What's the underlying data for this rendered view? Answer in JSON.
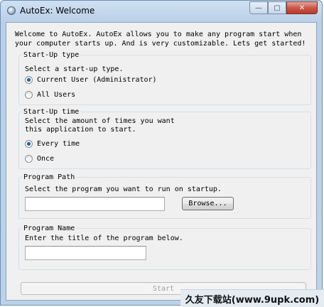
{
  "window": {
    "title": "AutoEx: Welcome"
  },
  "caption_buttons": {
    "minimize": "—",
    "maximize": "▢",
    "close": "✕"
  },
  "welcome_text": "Welcome to AutoEx. AutoEx allows you to make any program start when your computer starts up. And is very customizable. Lets get started!",
  "startup_type": {
    "legend": "Start-Up type",
    "instruction": "Select a start-up type.",
    "options": [
      {
        "label": "Current User (Administrator)",
        "selected": true
      },
      {
        "label": "All Users",
        "selected": false
      }
    ]
  },
  "startup_time": {
    "legend": "Start-Up time",
    "instruction": "Select the amount of times you want\nthis application to start.",
    "options": [
      {
        "label": "Every time",
        "selected": true
      },
      {
        "label": "Once",
        "selected": false
      }
    ]
  },
  "program_path": {
    "legend": "Program Path",
    "instruction": "Select the program you want to run on startup.",
    "value": "",
    "browse_label": "Browse..."
  },
  "program_name": {
    "legend": "Program Name",
    "instruction": "Enter the title of the program below.",
    "value": ""
  },
  "start_button": {
    "label": "Start",
    "enabled": false
  },
  "watermark": "久友下载站(www.9upk.com)"
}
